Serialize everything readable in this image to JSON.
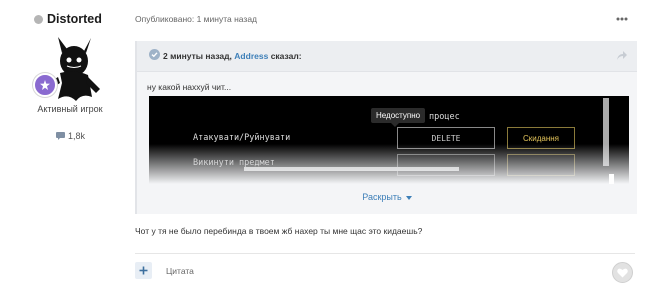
{
  "author": {
    "name": "Distorted",
    "title": "Активный игрок",
    "reputation": "1,8k",
    "online_color": "#b5b5b5",
    "rank_color": "#8a6ad0"
  },
  "post": {
    "meta": "Опубликовано: 1 минута назад",
    "body": "Чот у тя не было перебинда в твоем жб нахер ты мне щас это кидаешь?"
  },
  "quote": {
    "attribution_prefix": "2 минуты назад,",
    "user": "Address",
    "attribution_suffix": "сказал:",
    "text": "ну какой наххуй чит...",
    "expand_label": "Раскрыть",
    "screenshot": {
      "tooltip": "Недоступно",
      "process_label": "процес",
      "row1_label": "Атакувати/Руйнувати",
      "row2_label": "Викинути предмет",
      "delete_label": "DELETE",
      "reset_label": "Скидання"
    }
  },
  "actions": {
    "multiquote_symbol": "+",
    "quote_label": "Цитата"
  },
  "colors": {
    "link": "#3d7fb8",
    "accent_bg": "#f4f5f7"
  }
}
